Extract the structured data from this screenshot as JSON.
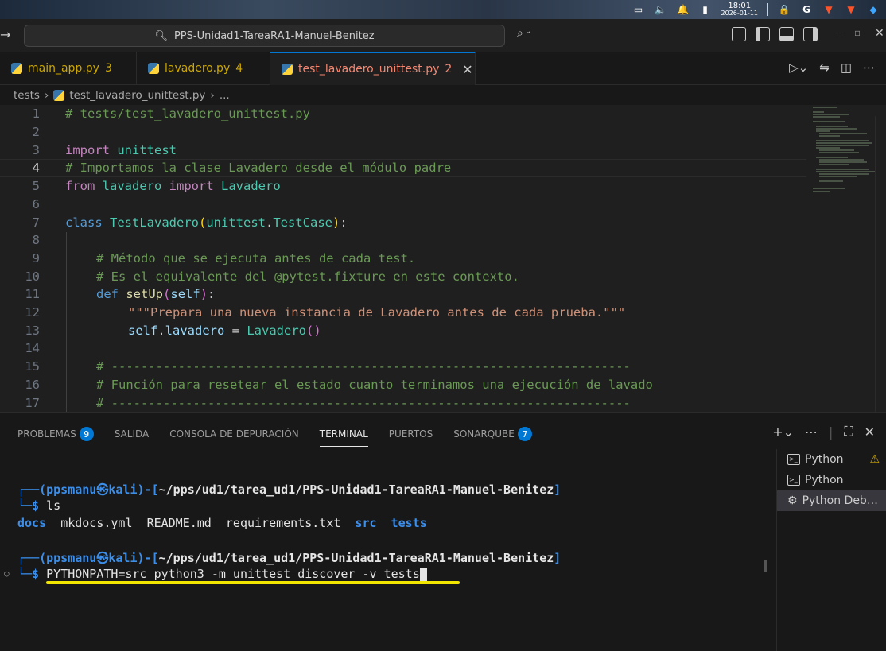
{
  "os_bar": {
    "time": "18:01",
    "date": "2026-01-11"
  },
  "titlebar": {
    "search_text": "PPS-Unidad1-TareaRA1-Manuel-Benitez"
  },
  "tabs": [
    {
      "label": "main_app.py",
      "problems": "3",
      "active": false
    },
    {
      "label": "lavadero.py",
      "problems": "4",
      "active": false
    },
    {
      "label": "test_lavadero_unittest.py",
      "problems": "2",
      "active": true
    }
  ],
  "breadcrumb": {
    "folder": "tests",
    "file": "test_lavadero_unittest.py",
    "more": "..."
  },
  "editor": {
    "line_numbers": [
      "1",
      "2",
      "3",
      "4",
      "5",
      "6",
      "7",
      "8",
      "9",
      "10",
      "11",
      "12",
      "13",
      "14",
      "15",
      "16",
      "17"
    ],
    "lines": {
      "l1": "# tests/test_lavadero_unittest.py",
      "l3_kw": "import",
      "l3_mod": "unittest",
      "l4": "# Importamos la clase Lavadero desde el módulo padre",
      "l5_from": "from",
      "l5_mod": "lavadero",
      "l5_import": "import",
      "l5_cls": "Lavadero",
      "l7_class": "class",
      "l7_name": "TestLavadero",
      "l7_base_mod": "unittest",
      "l7_base_cls": "TestCase",
      "l9": "# Método que se ejecuta antes de cada test.",
      "l10": "# Es el equivalente del @pytest.fixture en este contexto.",
      "l11_def": "def",
      "l11_fn": "setUp",
      "l11_self": "self",
      "l12": "\"\"\"Prepara una nueva instancia de Lavadero antes de cada prueba.\"\"\"",
      "l13_self": "self",
      "l13_attr": "lavadero",
      "l13_cls": "Lavadero",
      "l15": "# ----------------------------------------------------------------------",
      "l16": "# Función para resetear el estado cuanto terminamos una ejecución de lavado",
      "l17": "# ----------------------------------------------------------------------"
    }
  },
  "panel": {
    "tabs": [
      {
        "label": "PROBLEMAS",
        "badge": "9"
      },
      {
        "label": "SALIDA"
      },
      {
        "label": "CONSOLA DE DEPURACIÓN"
      },
      {
        "label": "TERMINAL",
        "active": true
      },
      {
        "label": "PUERTOS"
      },
      {
        "label": "SONARQUBE",
        "badge": "7"
      }
    ]
  },
  "terminal": {
    "user": "ppsmanu",
    "host": "kali",
    "path": "~/pps/ud1/tarea_ud1/PPS-Unidad1-TareaRA1-Manuel-Benitez",
    "cmd1": "ls",
    "ls_files": [
      "docs",
      "mkdocs.yml",
      "README.md",
      "requirements.txt",
      "src",
      "tests"
    ],
    "cmd2": "PYTHONPATH=src python3 -m unittest discover -v tests"
  },
  "terminal_list": [
    {
      "label": "Python",
      "warning": true
    },
    {
      "label": "Python"
    },
    {
      "label": "Python Deb…",
      "selected": true
    }
  ]
}
